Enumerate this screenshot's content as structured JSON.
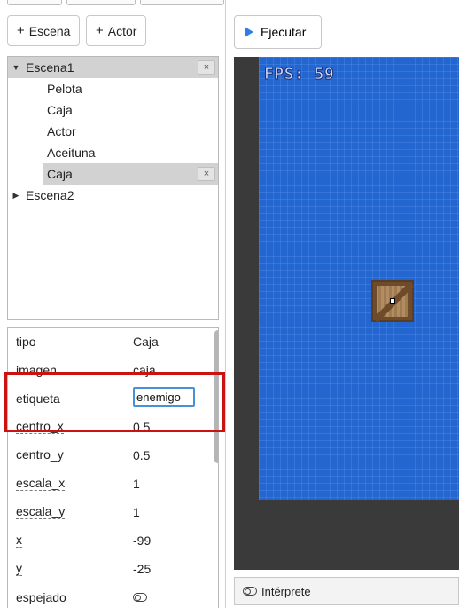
{
  "toolbar": {
    "add_scene_label": "Escena",
    "add_actor_label": "Actor",
    "run_label": "Ejecutar"
  },
  "tree": {
    "scenes": [
      {
        "label": "Escena1",
        "expanded": true,
        "close": "×",
        "children": [
          {
            "label": "Pelota"
          },
          {
            "label": "Caja"
          },
          {
            "label": "Actor"
          },
          {
            "label": "Aceituna"
          },
          {
            "label": "Caja",
            "selected": true,
            "close": "×"
          }
        ]
      },
      {
        "label": "Escena2",
        "expanded": false
      }
    ]
  },
  "properties": [
    {
      "name": "tipo",
      "value": "Caja"
    },
    {
      "name": "imagen",
      "value": "caja"
    },
    {
      "name": "etiqueta",
      "value": "enemigo",
      "editing": true
    },
    {
      "name": "centro_x",
      "value": "0.5"
    },
    {
      "name": "centro_y",
      "value": "0.5"
    },
    {
      "name": "escala_x",
      "value": "1"
    },
    {
      "name": "escala_y",
      "value": "1"
    },
    {
      "name": "x",
      "value": "-99"
    },
    {
      "name": "y",
      "value": "-25"
    },
    {
      "name": "espejado",
      "value": ""
    }
  ],
  "game": {
    "fps_text": "FPS: 59"
  },
  "interpreter": {
    "label": "Intérprete"
  },
  "colors": {
    "highlight": "#cc1111",
    "stage": "#2366cf",
    "accent": "#2f7ee6"
  }
}
